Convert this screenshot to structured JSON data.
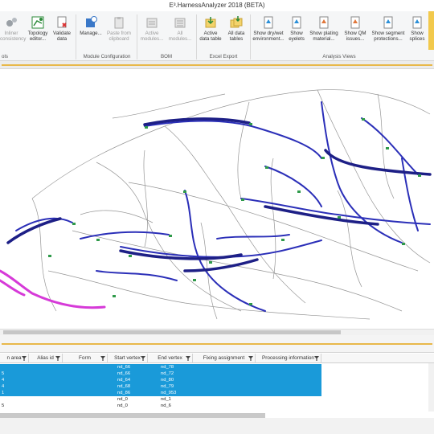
{
  "window": {
    "title": "E³.HarnessAnalyzer 2018 (BETA)"
  },
  "ribbon": {
    "buttons": [
      {
        "id": "inliner",
        "label": "Inliner\nconsistency",
        "disabled": true,
        "icon": "gears-icon"
      },
      {
        "id": "topology",
        "label": "Topology\neditor...",
        "disabled": false,
        "icon": "topology-editor-icon"
      },
      {
        "id": "validate",
        "label": "Validate\ndata",
        "disabled": false,
        "icon": "validate-document-icon"
      },
      {
        "id": "manage",
        "label": "Manage...",
        "disabled": false,
        "icon": "module-manage-icon"
      },
      {
        "id": "paste",
        "label": "Paste from\nclipboard",
        "disabled": true,
        "icon": "clipboard-icon"
      },
      {
        "id": "active_modules",
        "label": "Active\nmodules...",
        "disabled": true,
        "icon": "bom-modules-icon"
      },
      {
        "id": "all_modules",
        "label": "All\nmodules...",
        "disabled": true,
        "icon": "bom-all-modules-icon"
      },
      {
        "id": "active_table",
        "label": "Active\ndata table",
        "disabled": false,
        "icon": "excel-table-icon"
      },
      {
        "id": "all_tables",
        "label": "All data\ntables",
        "disabled": false,
        "icon": "excel-tables-icon"
      },
      {
        "id": "dry_wet",
        "label": "Show dry/wet\nenvironment...",
        "disabled": false,
        "icon": "analysis-view-icon"
      },
      {
        "id": "eyelets",
        "label": "Show\neyelets",
        "disabled": false,
        "icon": "analysis-view-icon"
      },
      {
        "id": "plating",
        "label": "Show plating\nmaterial...",
        "disabled": false,
        "icon": "analysis-view-icon"
      },
      {
        "id": "qm",
        "label": "Show QM\nissues...",
        "disabled": false,
        "icon": "analysis-view-icon"
      },
      {
        "id": "segment",
        "label": "Show segment\nprotections...",
        "disabled": false,
        "icon": "analysis-view-icon"
      },
      {
        "id": "splices",
        "label": "Show\nsplices",
        "disabled": false,
        "icon": "analysis-view-icon"
      }
    ],
    "groups": {
      "tools": "ols",
      "module": "Module Configuration",
      "bom": "BOM",
      "excel": "Excel Export",
      "analysis": "Analysis Views"
    }
  },
  "table": {
    "columns": [
      "n area",
      "Alias id",
      "Form",
      "Start vertex",
      "End vertex",
      "Fixing assignment",
      "Processing information"
    ],
    "rows": [
      {
        "a": "",
        "alias": "",
        "start": "nd_66",
        "end": "nd_78",
        "selected": true
      },
      {
        "a": "5",
        "alias": "",
        "start": "nd_66",
        "end": "nd_72",
        "selected": true
      },
      {
        "a": "4",
        "alias": "",
        "start": "nd_64",
        "end": "nd_80",
        "selected": true
      },
      {
        "a": "4",
        "alias": "",
        "start": "nd_68",
        "end": "nd_79",
        "selected": true
      },
      {
        "a": "1",
        "alias": "",
        "start": "nd_86",
        "end": "nd_953",
        "selected": true
      },
      {
        "a": "",
        "alias": "",
        "start": "nd_0",
        "end": "nd_1",
        "selected": false
      },
      {
        "a": "5",
        "alias": "",
        "start": "nd_0",
        "end": "nd_6",
        "selected": false
      }
    ]
  },
  "colors": {
    "selection": "#1a9ad9",
    "harness_main": "#2b2fb8",
    "harness_dark": "#1d1f86",
    "wire_gray": "#8a8a8a",
    "highlight": "#d63ad8",
    "connector": "#2f9a4a",
    "accent_line": "#e8b84a"
  }
}
